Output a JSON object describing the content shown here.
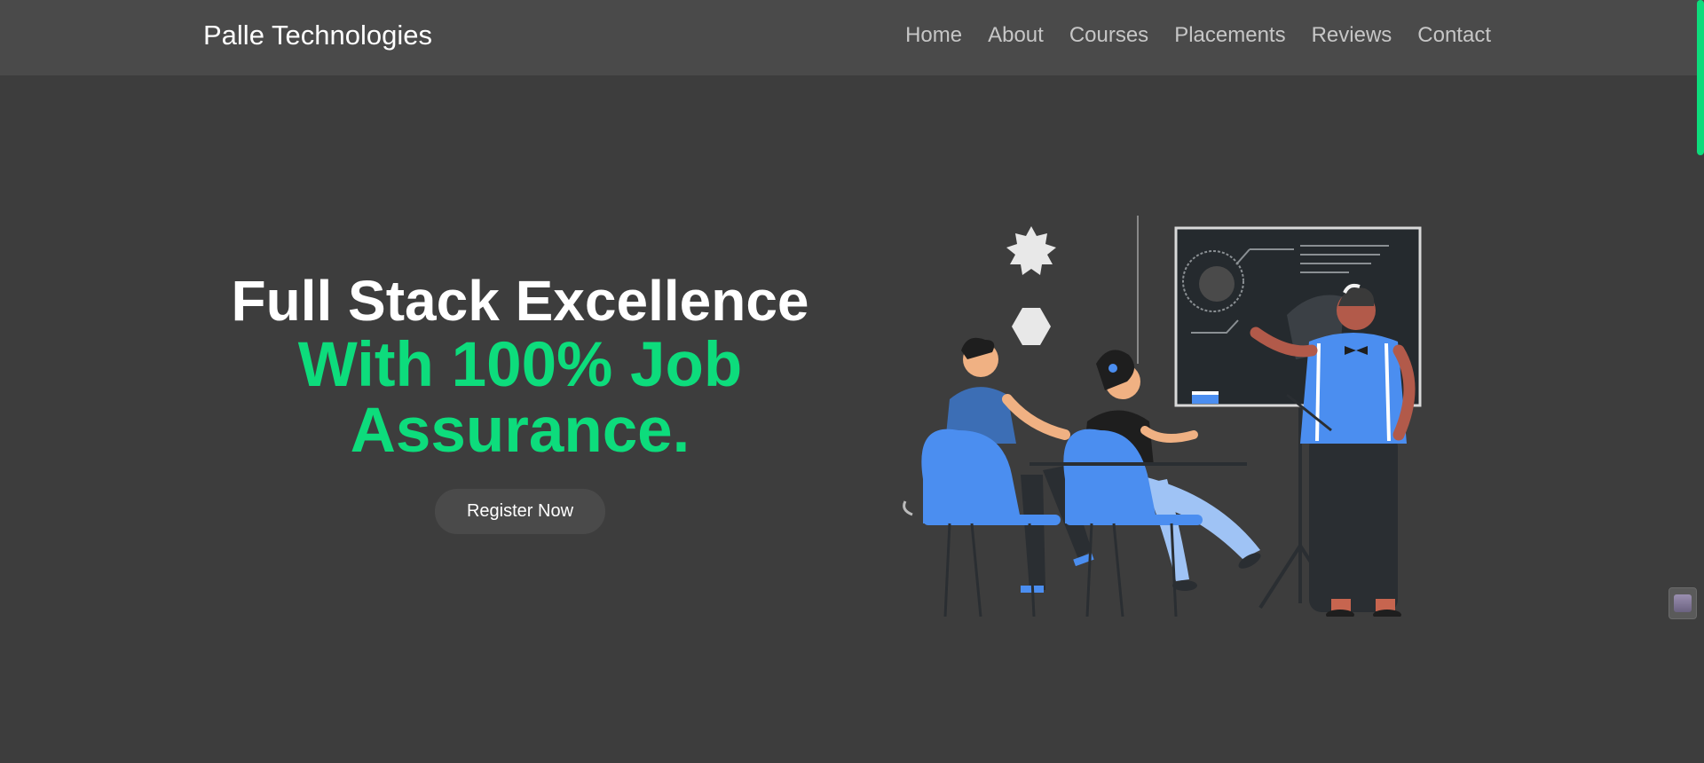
{
  "nav": {
    "brand": "Palle Technologies",
    "links": [
      "Home",
      "About",
      "Courses",
      "Placements",
      "Reviews",
      "Contact"
    ]
  },
  "hero": {
    "line1": "Full Stack Excellence",
    "line2": "With 100% Job",
    "line3": "Assurance.",
    "cta": "Register Now"
  },
  "colors": {
    "background": "#3d3d3d",
    "navbar": "#4a4a4a",
    "accent": "#0ddc7c",
    "figure_blue": "#4b8ef0"
  },
  "icons": {
    "illustration": "classroom-teaching-illustration",
    "widget": "chat-widget-icon"
  }
}
